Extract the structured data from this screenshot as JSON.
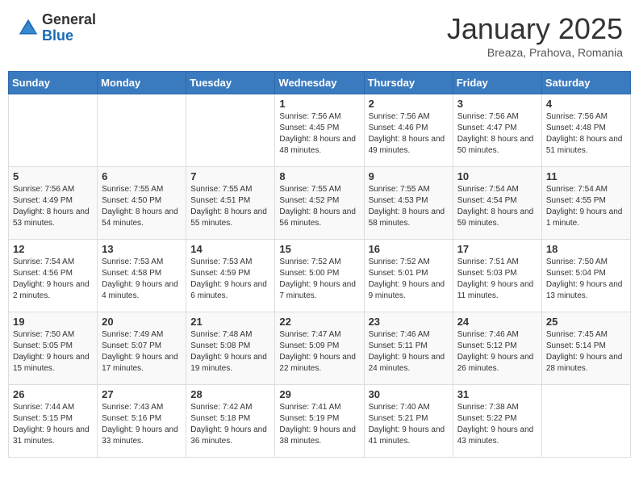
{
  "header": {
    "logo_general": "General",
    "logo_blue": "Blue",
    "month_title": "January 2025",
    "location": "Breaza, Prahova, Romania"
  },
  "weekdays": [
    "Sunday",
    "Monday",
    "Tuesday",
    "Wednesday",
    "Thursday",
    "Friday",
    "Saturday"
  ],
  "weeks": [
    [
      {
        "day": "",
        "info": ""
      },
      {
        "day": "",
        "info": ""
      },
      {
        "day": "",
        "info": ""
      },
      {
        "day": "1",
        "info": "Sunrise: 7:56 AM\nSunset: 4:45 PM\nDaylight: 8 hours\nand 48 minutes."
      },
      {
        "day": "2",
        "info": "Sunrise: 7:56 AM\nSunset: 4:46 PM\nDaylight: 8 hours\nand 49 minutes."
      },
      {
        "day": "3",
        "info": "Sunrise: 7:56 AM\nSunset: 4:47 PM\nDaylight: 8 hours\nand 50 minutes."
      },
      {
        "day": "4",
        "info": "Sunrise: 7:56 AM\nSunset: 4:48 PM\nDaylight: 8 hours\nand 51 minutes."
      }
    ],
    [
      {
        "day": "5",
        "info": "Sunrise: 7:56 AM\nSunset: 4:49 PM\nDaylight: 8 hours\nand 53 minutes."
      },
      {
        "day": "6",
        "info": "Sunrise: 7:55 AM\nSunset: 4:50 PM\nDaylight: 8 hours\nand 54 minutes."
      },
      {
        "day": "7",
        "info": "Sunrise: 7:55 AM\nSunset: 4:51 PM\nDaylight: 8 hours\nand 55 minutes."
      },
      {
        "day": "8",
        "info": "Sunrise: 7:55 AM\nSunset: 4:52 PM\nDaylight: 8 hours\nand 56 minutes."
      },
      {
        "day": "9",
        "info": "Sunrise: 7:55 AM\nSunset: 4:53 PM\nDaylight: 8 hours\nand 58 minutes."
      },
      {
        "day": "10",
        "info": "Sunrise: 7:54 AM\nSunset: 4:54 PM\nDaylight: 8 hours\nand 59 minutes."
      },
      {
        "day": "11",
        "info": "Sunrise: 7:54 AM\nSunset: 4:55 PM\nDaylight: 9 hours\nand 1 minute."
      }
    ],
    [
      {
        "day": "12",
        "info": "Sunrise: 7:54 AM\nSunset: 4:56 PM\nDaylight: 9 hours\nand 2 minutes."
      },
      {
        "day": "13",
        "info": "Sunrise: 7:53 AM\nSunset: 4:58 PM\nDaylight: 9 hours\nand 4 minutes."
      },
      {
        "day": "14",
        "info": "Sunrise: 7:53 AM\nSunset: 4:59 PM\nDaylight: 9 hours\nand 6 minutes."
      },
      {
        "day": "15",
        "info": "Sunrise: 7:52 AM\nSunset: 5:00 PM\nDaylight: 9 hours\nand 7 minutes."
      },
      {
        "day": "16",
        "info": "Sunrise: 7:52 AM\nSunset: 5:01 PM\nDaylight: 9 hours\nand 9 minutes."
      },
      {
        "day": "17",
        "info": "Sunrise: 7:51 AM\nSunset: 5:03 PM\nDaylight: 9 hours\nand 11 minutes."
      },
      {
        "day": "18",
        "info": "Sunrise: 7:50 AM\nSunset: 5:04 PM\nDaylight: 9 hours\nand 13 minutes."
      }
    ],
    [
      {
        "day": "19",
        "info": "Sunrise: 7:50 AM\nSunset: 5:05 PM\nDaylight: 9 hours\nand 15 minutes."
      },
      {
        "day": "20",
        "info": "Sunrise: 7:49 AM\nSunset: 5:07 PM\nDaylight: 9 hours\nand 17 minutes."
      },
      {
        "day": "21",
        "info": "Sunrise: 7:48 AM\nSunset: 5:08 PM\nDaylight: 9 hours\nand 19 minutes."
      },
      {
        "day": "22",
        "info": "Sunrise: 7:47 AM\nSunset: 5:09 PM\nDaylight: 9 hours\nand 22 minutes."
      },
      {
        "day": "23",
        "info": "Sunrise: 7:46 AM\nSunset: 5:11 PM\nDaylight: 9 hours\nand 24 minutes."
      },
      {
        "day": "24",
        "info": "Sunrise: 7:46 AM\nSunset: 5:12 PM\nDaylight: 9 hours\nand 26 minutes."
      },
      {
        "day": "25",
        "info": "Sunrise: 7:45 AM\nSunset: 5:14 PM\nDaylight: 9 hours\nand 28 minutes."
      }
    ],
    [
      {
        "day": "26",
        "info": "Sunrise: 7:44 AM\nSunset: 5:15 PM\nDaylight: 9 hours\nand 31 minutes."
      },
      {
        "day": "27",
        "info": "Sunrise: 7:43 AM\nSunset: 5:16 PM\nDaylight: 9 hours\nand 33 minutes."
      },
      {
        "day": "28",
        "info": "Sunrise: 7:42 AM\nSunset: 5:18 PM\nDaylight: 9 hours\nand 36 minutes."
      },
      {
        "day": "29",
        "info": "Sunrise: 7:41 AM\nSunset: 5:19 PM\nDaylight: 9 hours\nand 38 minutes."
      },
      {
        "day": "30",
        "info": "Sunrise: 7:40 AM\nSunset: 5:21 PM\nDaylight: 9 hours\nand 41 minutes."
      },
      {
        "day": "31",
        "info": "Sunrise: 7:38 AM\nSunset: 5:22 PM\nDaylight: 9 hours\nand 43 minutes."
      },
      {
        "day": "",
        "info": ""
      }
    ]
  ]
}
